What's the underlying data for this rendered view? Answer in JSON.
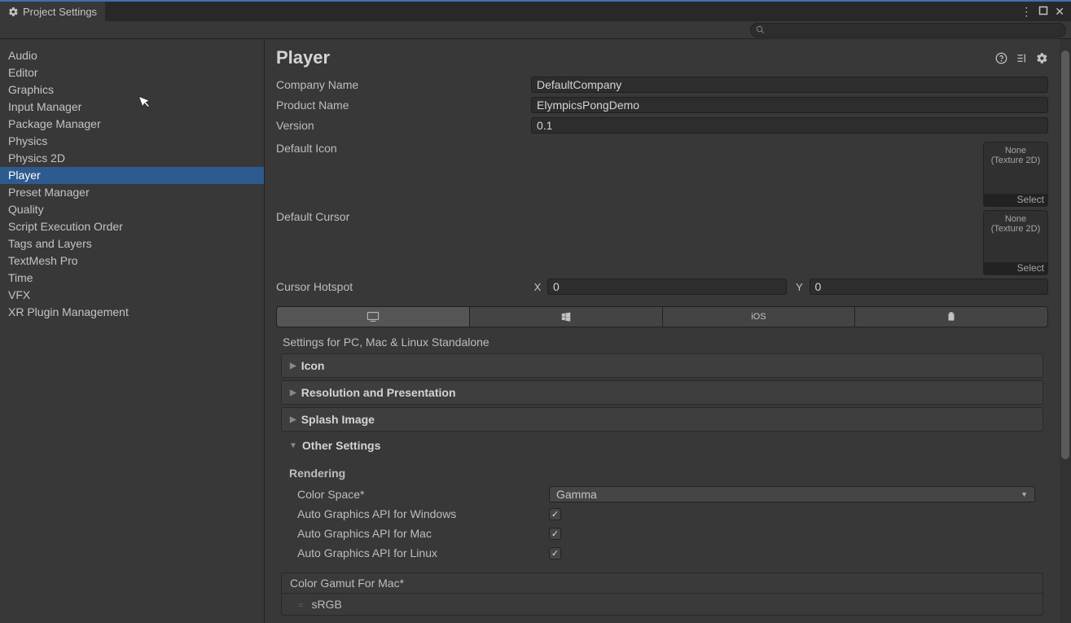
{
  "window": {
    "title": "Project Settings"
  },
  "sidebar": {
    "items": [
      "Audio",
      "Editor",
      "Graphics",
      "Input Manager",
      "Package Manager",
      "Physics",
      "Physics 2D",
      "Player",
      "Preset Manager",
      "Quality",
      "Script Execution Order",
      "Tags and Layers",
      "TextMesh Pro",
      "Time",
      "VFX",
      "XR Plugin Management"
    ],
    "selected": "Player"
  },
  "header": {
    "title": "Player"
  },
  "fields": {
    "company_label": "Company Name",
    "company_value": "DefaultCompany",
    "product_label": "Product Name",
    "product_value": "ElympicsPongDemo",
    "version_label": "Version",
    "version_value": "0.1",
    "default_icon_label": "Default Icon",
    "default_cursor_label": "Default Cursor",
    "cursor_hotspot_label": "Cursor Hotspot",
    "cursor_x": "0",
    "cursor_y": "0",
    "x_label": "X",
    "y_label": "Y"
  },
  "texture_slot": {
    "none": "None",
    "type": "(Texture 2D)",
    "select": "Select"
  },
  "platform_tabs": {
    "standalone": "",
    "windows": "",
    "ios": "iOS",
    "android": ""
  },
  "sections": {
    "settings_for": "Settings for PC, Mac & Linux Standalone",
    "icon": "Icon",
    "resolution": "Resolution and Presentation",
    "splash": "Splash Image",
    "other": "Other Settings"
  },
  "other": {
    "rendering": "Rendering",
    "color_space_label": "Color Space*",
    "color_space_value": "Gamma",
    "auto_win": "Auto Graphics API  for Windows",
    "auto_mac": "Auto Graphics API  for Mac",
    "auto_linux": "Auto Graphics API  for Linux",
    "gamut_title": "Color Gamut For Mac*",
    "gamut_item": "sRGB"
  }
}
